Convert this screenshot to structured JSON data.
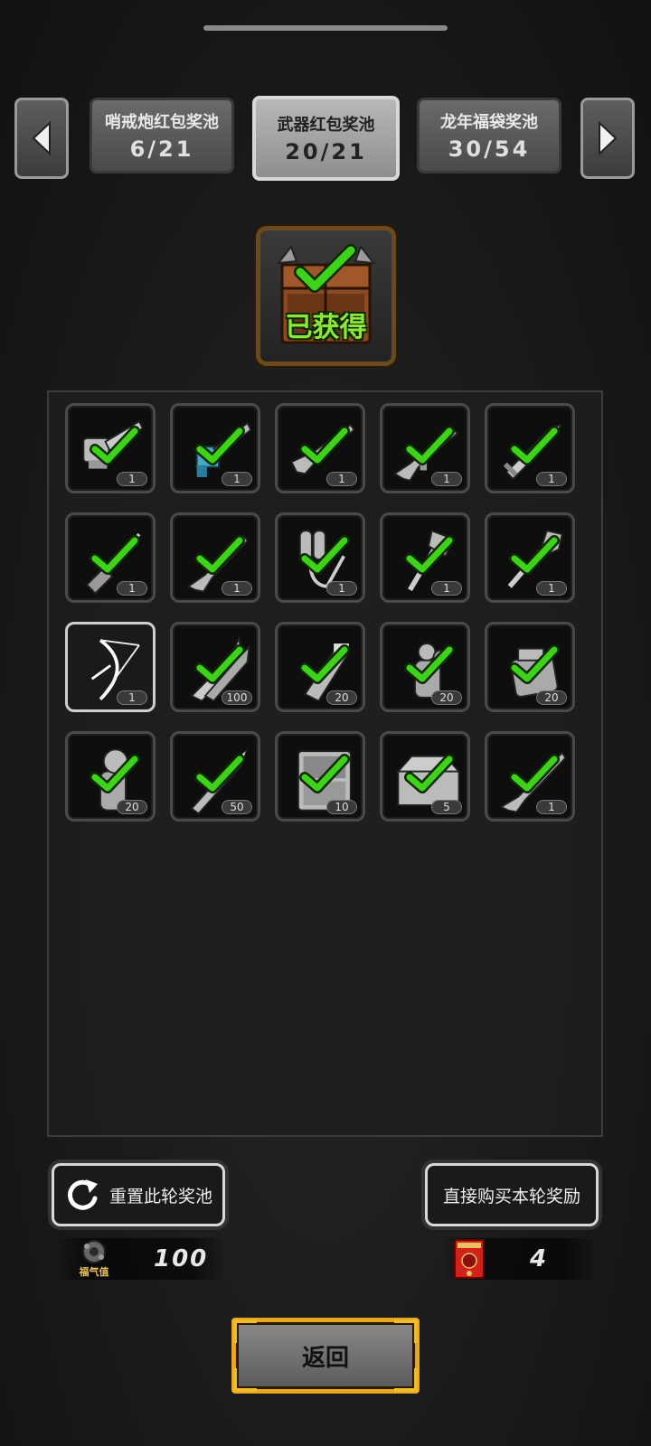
{
  "tabs": [
    {
      "name": "哨戒炮红包奖池",
      "count": "6/21",
      "active": false
    },
    {
      "name": "武器红包奖池",
      "count": "20/21",
      "active": true
    },
    {
      "name": "龙年福袋奖池",
      "count": "30/54",
      "active": false
    }
  ],
  "chest": {
    "status_label": "已获得"
  },
  "items": [
    {
      "icon": "chainsaw-icon",
      "qty": "1"
    },
    {
      "icon": "minigun-icon",
      "qty": "1"
    },
    {
      "icon": "shotgun-icon",
      "qty": "1"
    },
    {
      "icon": "assault-rifle-icon",
      "qty": "1"
    },
    {
      "icon": "broadsword-icon",
      "qty": "1"
    },
    {
      "icon": "screwdriver-icon",
      "qty": "1"
    },
    {
      "icon": "rifle-icon",
      "qty": "1"
    },
    {
      "icon": "flamethrower-icon",
      "qty": "1"
    },
    {
      "icon": "axe-icon",
      "qty": "1"
    },
    {
      "icon": "shovel-icon",
      "qty": "1"
    },
    {
      "icon": "compound-bow-icon",
      "qty": "1",
      "selected": true
    },
    {
      "icon": "arrows-icon",
      "qty": "100"
    },
    {
      "icon": "ammo-magazine-icon",
      "qty": "20"
    },
    {
      "icon": "grenade-pack-icon",
      "qty": "20"
    },
    {
      "icon": "explosive-pack-icon",
      "qty": "20"
    },
    {
      "icon": "gas-grenade-icon",
      "qty": "20"
    },
    {
      "icon": "rocket-icon",
      "qty": "50"
    },
    {
      "icon": "toolkit-case-icon",
      "qty": "10"
    },
    {
      "icon": "toolbox-icon",
      "qty": "5"
    },
    {
      "icon": "sniper-rifle-icon",
      "qty": "1"
    }
  ],
  "buttons": {
    "reset_pool": "重置此轮奖池",
    "buy_rewards": "直接购买本轮奖励",
    "back": "返回"
  },
  "stats": {
    "fortune_caption": "福气值",
    "fortune_value": "100",
    "red_envelope_value": "4"
  },
  "colors": {
    "check": "#3fd21a",
    "gold": "#e7a81f",
    "chest_wood": "#8a4a22"
  }
}
